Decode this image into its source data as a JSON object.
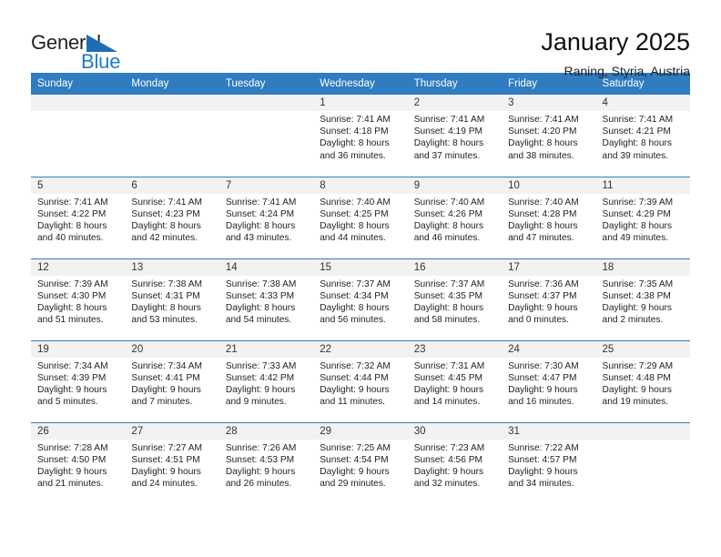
{
  "brand": {
    "name_part1": "General",
    "name_part2": "Blue",
    "triangle_color": "#1c6db4",
    "blue_color": "#1f7dc4"
  },
  "header": {
    "month_title": "January 2025",
    "location": "Raning, Styria, Austria"
  },
  "theme": {
    "header_blue": "#2f7cc0",
    "daynum_band": "#f2f2f2"
  },
  "weekday_headers": [
    "Sunday",
    "Monday",
    "Tuesday",
    "Wednesday",
    "Thursday",
    "Friday",
    "Saturday"
  ],
  "weeks": [
    [
      {
        "day": "",
        "empty": true,
        "sunrise": "",
        "sunset": "",
        "daylight_line1": "",
        "daylight_line2": ""
      },
      {
        "day": "",
        "empty": true,
        "sunrise": "",
        "sunset": "",
        "daylight_line1": "",
        "daylight_line2": ""
      },
      {
        "day": "",
        "empty": true,
        "sunrise": "",
        "sunset": "",
        "daylight_line1": "",
        "daylight_line2": ""
      },
      {
        "day": "1",
        "sunrise": "Sunrise: 7:41 AM",
        "sunset": "Sunset: 4:18 PM",
        "daylight_line1": "Daylight: 8 hours",
        "daylight_line2": "and 36 minutes."
      },
      {
        "day": "2",
        "sunrise": "Sunrise: 7:41 AM",
        "sunset": "Sunset: 4:19 PM",
        "daylight_line1": "Daylight: 8 hours",
        "daylight_line2": "and 37 minutes."
      },
      {
        "day": "3",
        "sunrise": "Sunrise: 7:41 AM",
        "sunset": "Sunset: 4:20 PM",
        "daylight_line1": "Daylight: 8 hours",
        "daylight_line2": "and 38 minutes."
      },
      {
        "day": "4",
        "sunrise": "Sunrise: 7:41 AM",
        "sunset": "Sunset: 4:21 PM",
        "daylight_line1": "Daylight: 8 hours",
        "daylight_line2": "and 39 minutes."
      }
    ],
    [
      {
        "day": "5",
        "sunrise": "Sunrise: 7:41 AM",
        "sunset": "Sunset: 4:22 PM",
        "daylight_line1": "Daylight: 8 hours",
        "daylight_line2": "and 40 minutes."
      },
      {
        "day": "6",
        "sunrise": "Sunrise: 7:41 AM",
        "sunset": "Sunset: 4:23 PM",
        "daylight_line1": "Daylight: 8 hours",
        "daylight_line2": "and 42 minutes."
      },
      {
        "day": "7",
        "sunrise": "Sunrise: 7:41 AM",
        "sunset": "Sunset: 4:24 PM",
        "daylight_line1": "Daylight: 8 hours",
        "daylight_line2": "and 43 minutes."
      },
      {
        "day": "8",
        "sunrise": "Sunrise: 7:40 AM",
        "sunset": "Sunset: 4:25 PM",
        "daylight_line1": "Daylight: 8 hours",
        "daylight_line2": "and 44 minutes."
      },
      {
        "day": "9",
        "sunrise": "Sunrise: 7:40 AM",
        "sunset": "Sunset: 4:26 PM",
        "daylight_line1": "Daylight: 8 hours",
        "daylight_line2": "and 46 minutes."
      },
      {
        "day": "10",
        "sunrise": "Sunrise: 7:40 AM",
        "sunset": "Sunset: 4:28 PM",
        "daylight_line1": "Daylight: 8 hours",
        "daylight_line2": "and 47 minutes."
      },
      {
        "day": "11",
        "sunrise": "Sunrise: 7:39 AM",
        "sunset": "Sunset: 4:29 PM",
        "daylight_line1": "Daylight: 8 hours",
        "daylight_line2": "and 49 minutes."
      }
    ],
    [
      {
        "day": "12",
        "sunrise": "Sunrise: 7:39 AM",
        "sunset": "Sunset: 4:30 PM",
        "daylight_line1": "Daylight: 8 hours",
        "daylight_line2": "and 51 minutes."
      },
      {
        "day": "13",
        "sunrise": "Sunrise: 7:38 AM",
        "sunset": "Sunset: 4:31 PM",
        "daylight_line1": "Daylight: 8 hours",
        "daylight_line2": "and 53 minutes."
      },
      {
        "day": "14",
        "sunrise": "Sunrise: 7:38 AM",
        "sunset": "Sunset: 4:33 PM",
        "daylight_line1": "Daylight: 8 hours",
        "daylight_line2": "and 54 minutes."
      },
      {
        "day": "15",
        "sunrise": "Sunrise: 7:37 AM",
        "sunset": "Sunset: 4:34 PM",
        "daylight_line1": "Daylight: 8 hours",
        "daylight_line2": "and 56 minutes."
      },
      {
        "day": "16",
        "sunrise": "Sunrise: 7:37 AM",
        "sunset": "Sunset: 4:35 PM",
        "daylight_line1": "Daylight: 8 hours",
        "daylight_line2": "and 58 minutes."
      },
      {
        "day": "17",
        "sunrise": "Sunrise: 7:36 AM",
        "sunset": "Sunset: 4:37 PM",
        "daylight_line1": "Daylight: 9 hours",
        "daylight_line2": "and 0 minutes."
      },
      {
        "day": "18",
        "sunrise": "Sunrise: 7:35 AM",
        "sunset": "Sunset: 4:38 PM",
        "daylight_line1": "Daylight: 9 hours",
        "daylight_line2": "and 2 minutes."
      }
    ],
    [
      {
        "day": "19",
        "sunrise": "Sunrise: 7:34 AM",
        "sunset": "Sunset: 4:39 PM",
        "daylight_line1": "Daylight: 9 hours",
        "daylight_line2": "and 5 minutes."
      },
      {
        "day": "20",
        "sunrise": "Sunrise: 7:34 AM",
        "sunset": "Sunset: 4:41 PM",
        "daylight_line1": "Daylight: 9 hours",
        "daylight_line2": "and 7 minutes."
      },
      {
        "day": "21",
        "sunrise": "Sunrise: 7:33 AM",
        "sunset": "Sunset: 4:42 PM",
        "daylight_line1": "Daylight: 9 hours",
        "daylight_line2": "and 9 minutes."
      },
      {
        "day": "22",
        "sunrise": "Sunrise: 7:32 AM",
        "sunset": "Sunset: 4:44 PM",
        "daylight_line1": "Daylight: 9 hours",
        "daylight_line2": "and 11 minutes."
      },
      {
        "day": "23",
        "sunrise": "Sunrise: 7:31 AM",
        "sunset": "Sunset: 4:45 PM",
        "daylight_line1": "Daylight: 9 hours",
        "daylight_line2": "and 14 minutes."
      },
      {
        "day": "24",
        "sunrise": "Sunrise: 7:30 AM",
        "sunset": "Sunset: 4:47 PM",
        "daylight_line1": "Daylight: 9 hours",
        "daylight_line2": "and 16 minutes."
      },
      {
        "day": "25",
        "sunrise": "Sunrise: 7:29 AM",
        "sunset": "Sunset: 4:48 PM",
        "daylight_line1": "Daylight: 9 hours",
        "daylight_line2": "and 19 minutes."
      }
    ],
    [
      {
        "day": "26",
        "sunrise": "Sunrise: 7:28 AM",
        "sunset": "Sunset: 4:50 PM",
        "daylight_line1": "Daylight: 9 hours",
        "daylight_line2": "and 21 minutes."
      },
      {
        "day": "27",
        "sunrise": "Sunrise: 7:27 AM",
        "sunset": "Sunset: 4:51 PM",
        "daylight_line1": "Daylight: 9 hours",
        "daylight_line2": "and 24 minutes."
      },
      {
        "day": "28",
        "sunrise": "Sunrise: 7:26 AM",
        "sunset": "Sunset: 4:53 PM",
        "daylight_line1": "Daylight: 9 hours",
        "daylight_line2": "and 26 minutes."
      },
      {
        "day": "29",
        "sunrise": "Sunrise: 7:25 AM",
        "sunset": "Sunset: 4:54 PM",
        "daylight_line1": "Daylight: 9 hours",
        "daylight_line2": "and 29 minutes."
      },
      {
        "day": "30",
        "sunrise": "Sunrise: 7:23 AM",
        "sunset": "Sunset: 4:56 PM",
        "daylight_line1": "Daylight: 9 hours",
        "daylight_line2": "and 32 minutes."
      },
      {
        "day": "31",
        "sunrise": "Sunrise: 7:22 AM",
        "sunset": "Sunset: 4:57 PM",
        "daylight_line1": "Daylight: 9 hours",
        "daylight_line2": "and 34 minutes."
      },
      {
        "day": "",
        "empty": true,
        "sunrise": "",
        "sunset": "",
        "daylight_line1": "",
        "daylight_line2": ""
      }
    ]
  ]
}
